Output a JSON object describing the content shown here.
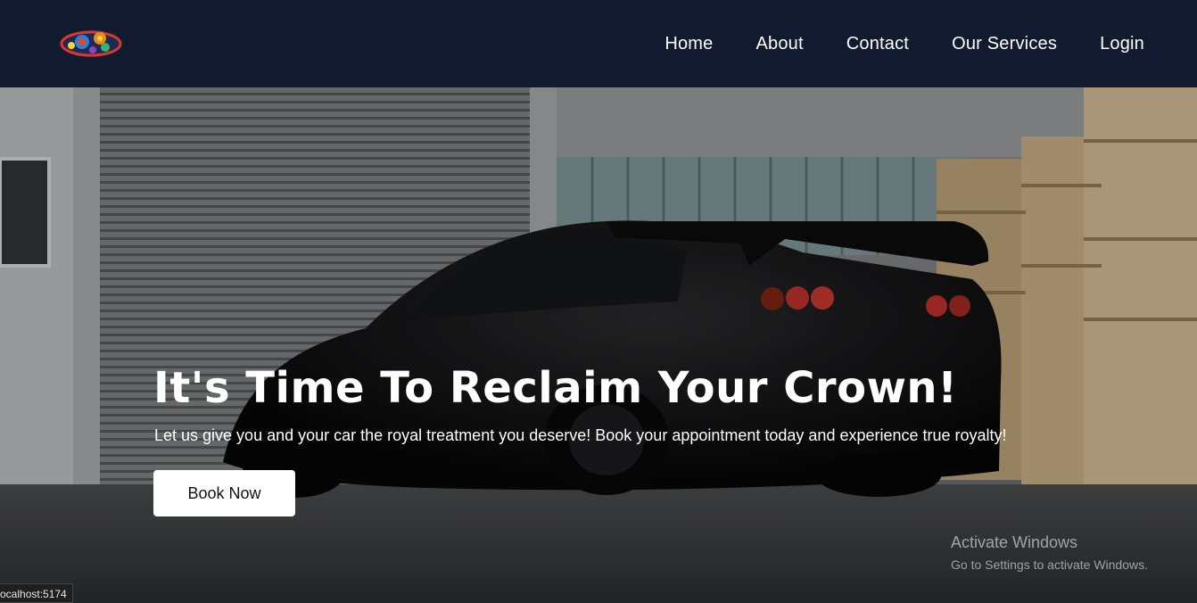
{
  "nav": {
    "links": [
      {
        "label": "Home"
      },
      {
        "label": "About"
      },
      {
        "label": "Contact"
      },
      {
        "label": "Our Services"
      },
      {
        "label": "Login"
      }
    ]
  },
  "hero": {
    "title": "It's Time To Reclaim Your Crown!",
    "subtitle": "Let us give you and your car the royal treatment you deserve! Book your appointment today and experience true royalty!",
    "cta_label": "Book Now",
    "image": "black sports car in warehouse"
  },
  "watermark": {
    "title": "Activate Windows",
    "subtitle": "Go to Settings to activate Windows."
  },
  "status_bar": {
    "url": "ocalhost:5174"
  },
  "colors": {
    "nav_bg": "#111a2e",
    "button_bg": "#ffffff",
    "text": "#ffffff"
  }
}
